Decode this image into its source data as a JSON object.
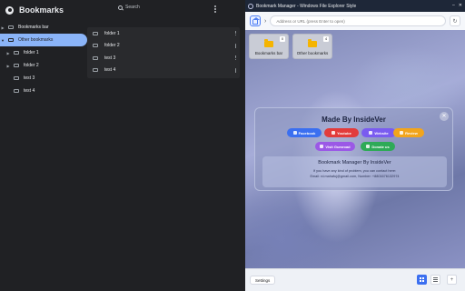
{
  "bookmarks": {
    "title": "Bookmarks",
    "search_placeholder": "Search",
    "tree": [
      {
        "label": "Bookmarks bar"
      },
      {
        "label": "Other bookmarks"
      },
      {
        "label": "folder 1"
      },
      {
        "label": "folder 2"
      },
      {
        "label": "test 3"
      },
      {
        "label": "test 4"
      }
    ],
    "list": [
      {
        "label": "folder 1"
      },
      {
        "label": "folder 2"
      },
      {
        "label": "test 3"
      },
      {
        "label": "test 4"
      }
    ]
  },
  "popup": {
    "window_title": "Bookmark Manager - Windows File Explorer Style",
    "address_placeholder": "Address or URL (press Enter to open)",
    "tiles": [
      {
        "label": "Bookmarks bar",
        "count": "0"
      },
      {
        "label": "Other bookmarks",
        "count": "4"
      }
    ],
    "modal": {
      "title": "Made By InsideVer",
      "buttons": {
        "facebook": "Facebook",
        "youtube": "Youtube",
        "website": "Website",
        "review": "Review",
        "gumroad": "Visit Gumroad",
        "donate": "Donate us"
      },
      "info_title": "Bookmark Manager By InsideVer",
      "info_line1": "If you have any kind of problem, you can contact here:",
      "info_line2": "Email: rd.mahafuj@gmail.com, Number: +8801676132974"
    },
    "settings_label": "Settings",
    "add_label": "+"
  },
  "colors": {
    "accent": "#8ab4f8",
    "facebook": "#3b6ff0",
    "youtube": "#e23b3b",
    "website": "#7a5cf0",
    "review": "#f2a51c",
    "gumroad": "#9b59e6",
    "donate": "#2eaa57"
  }
}
